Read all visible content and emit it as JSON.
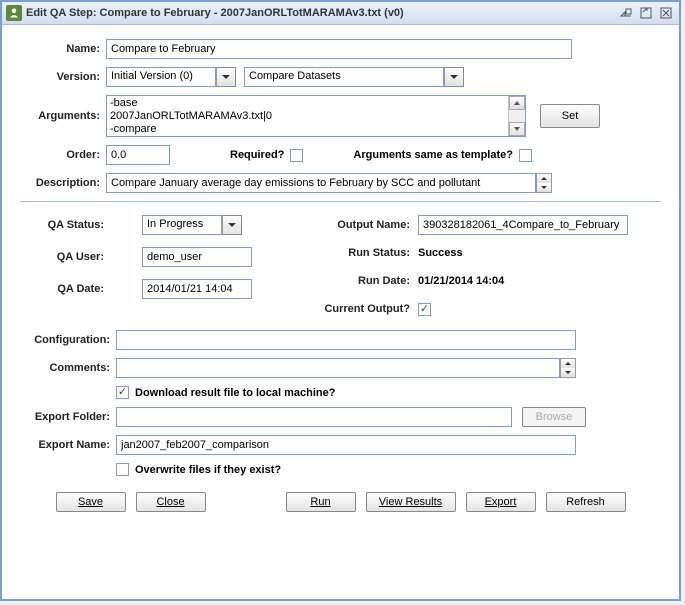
{
  "window": {
    "title": "Edit QA Step: Compare to February - 2007JanORLTotMARAMAv3.txt (v0)"
  },
  "labels": {
    "name": "Name:",
    "version": "Version:",
    "arguments": "Arguments:",
    "order": "Order:",
    "required": "Required?",
    "args_same": "Arguments same as template?",
    "description": "Description:",
    "qa_status": "QA Status:",
    "qa_user": "QA User:",
    "qa_date": "QA Date:",
    "output_name": "Output Name:",
    "run_status": "Run Status:",
    "run_date": "Run Date:",
    "current_output": "Current Output?",
    "configuration": "Configuration:",
    "comments": "Comments:",
    "download": "Download result file to local machine?",
    "export_folder": "Export Folder:",
    "export_name": "Export Name:",
    "overwrite": "Overwrite files if they exist?"
  },
  "values": {
    "name": "Compare to February",
    "version_text": "Initial Version (0)",
    "program": "Compare Datasets",
    "arguments_line1": "-base",
    "arguments_line2": "2007JanORLTotMARAMAv3.txt|0",
    "arguments_line3": "-compare",
    "order": "0.0",
    "description": "Compare January average day emissions to February by SCC and pollutant",
    "qa_status": "In Progress",
    "qa_user": "demo_user",
    "qa_date": "2014/01/21 14:04",
    "output_name": "390328182061_4Compare_to_February",
    "run_status": "Success",
    "run_date": "01/21/2014 14:04",
    "configuration": "",
    "comments": "",
    "export_folder": "",
    "export_name": "jan2007_feb2007_comparison"
  },
  "buttons": {
    "set": "Set",
    "browse": "Browse",
    "save": "Save",
    "close": "Close",
    "run": "Run",
    "view_results": "View Results",
    "export": "Export",
    "refresh": "Refresh"
  }
}
